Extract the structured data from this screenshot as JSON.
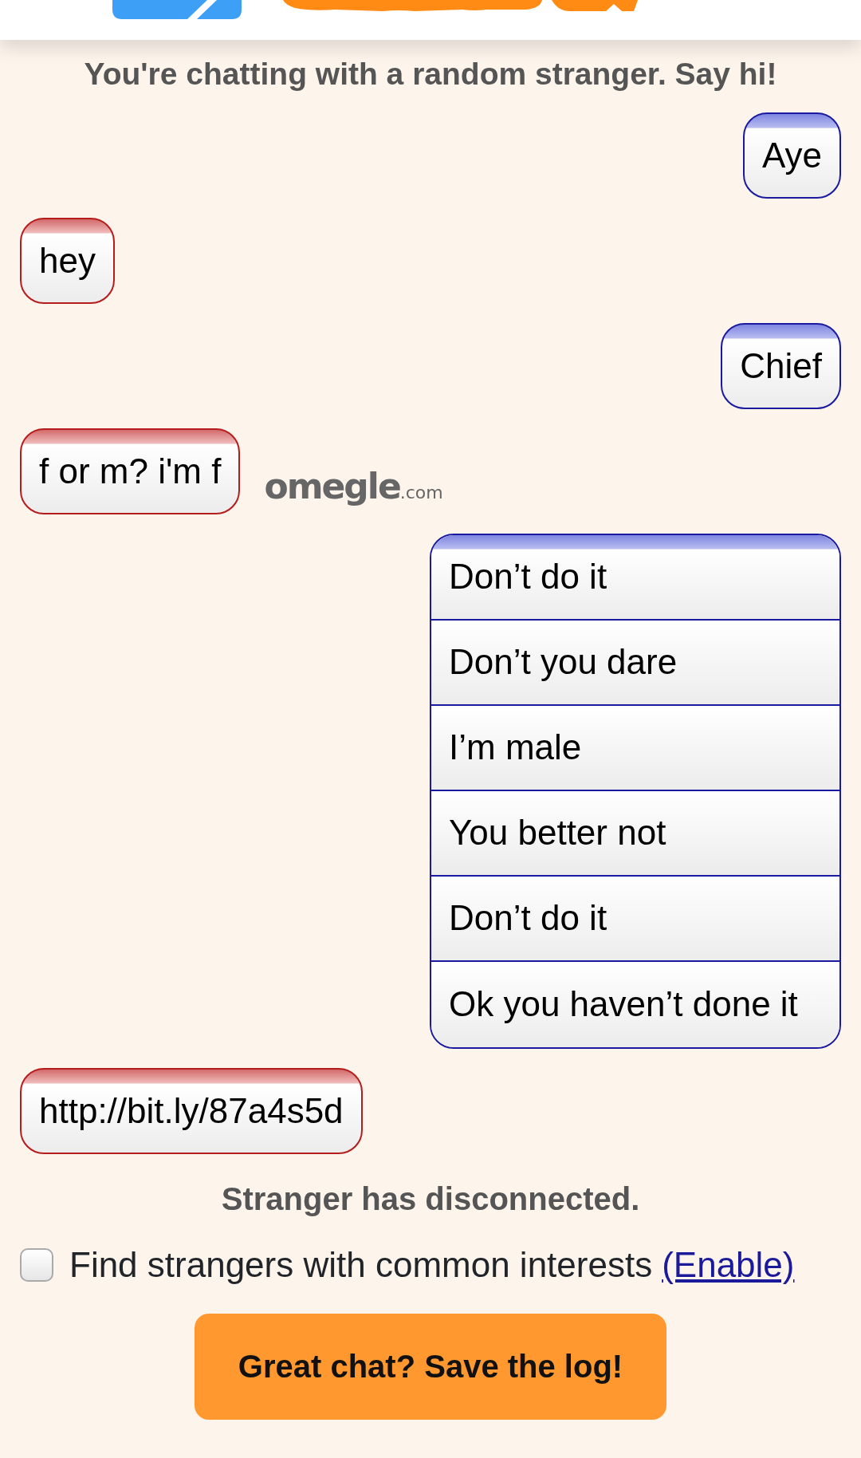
{
  "status_line": "You're chatting with a random stranger. Say hi!",
  "messages": [
    {
      "kind": "you",
      "lines": [
        "Aye"
      ]
    },
    {
      "kind": "stranger",
      "lines": [
        "hey"
      ]
    },
    {
      "kind": "you",
      "lines": [
        "Chief"
      ]
    },
    {
      "kind": "stranger",
      "lines": [
        "f or m? i'm f"
      ]
    },
    {
      "kind": "you",
      "lines": [
        "Don’t do it",
        "Don’t you dare",
        "I’m male",
        "You better not",
        "Don’t do it",
        "Ok you haven’t done it"
      ]
    },
    {
      "kind": "stranger",
      "lines": [
        "http://bit.ly/87a4s5d"
      ]
    }
  ],
  "log_logo": {
    "name": "omegle",
    "domain": ".com"
  },
  "disconnect_notice": "Stranger has disconnected.",
  "interests": {
    "label": "Find strangers with common interests",
    "link": "(Enable)",
    "checked": false
  },
  "save_button": "Great chat? Save the log!"
}
